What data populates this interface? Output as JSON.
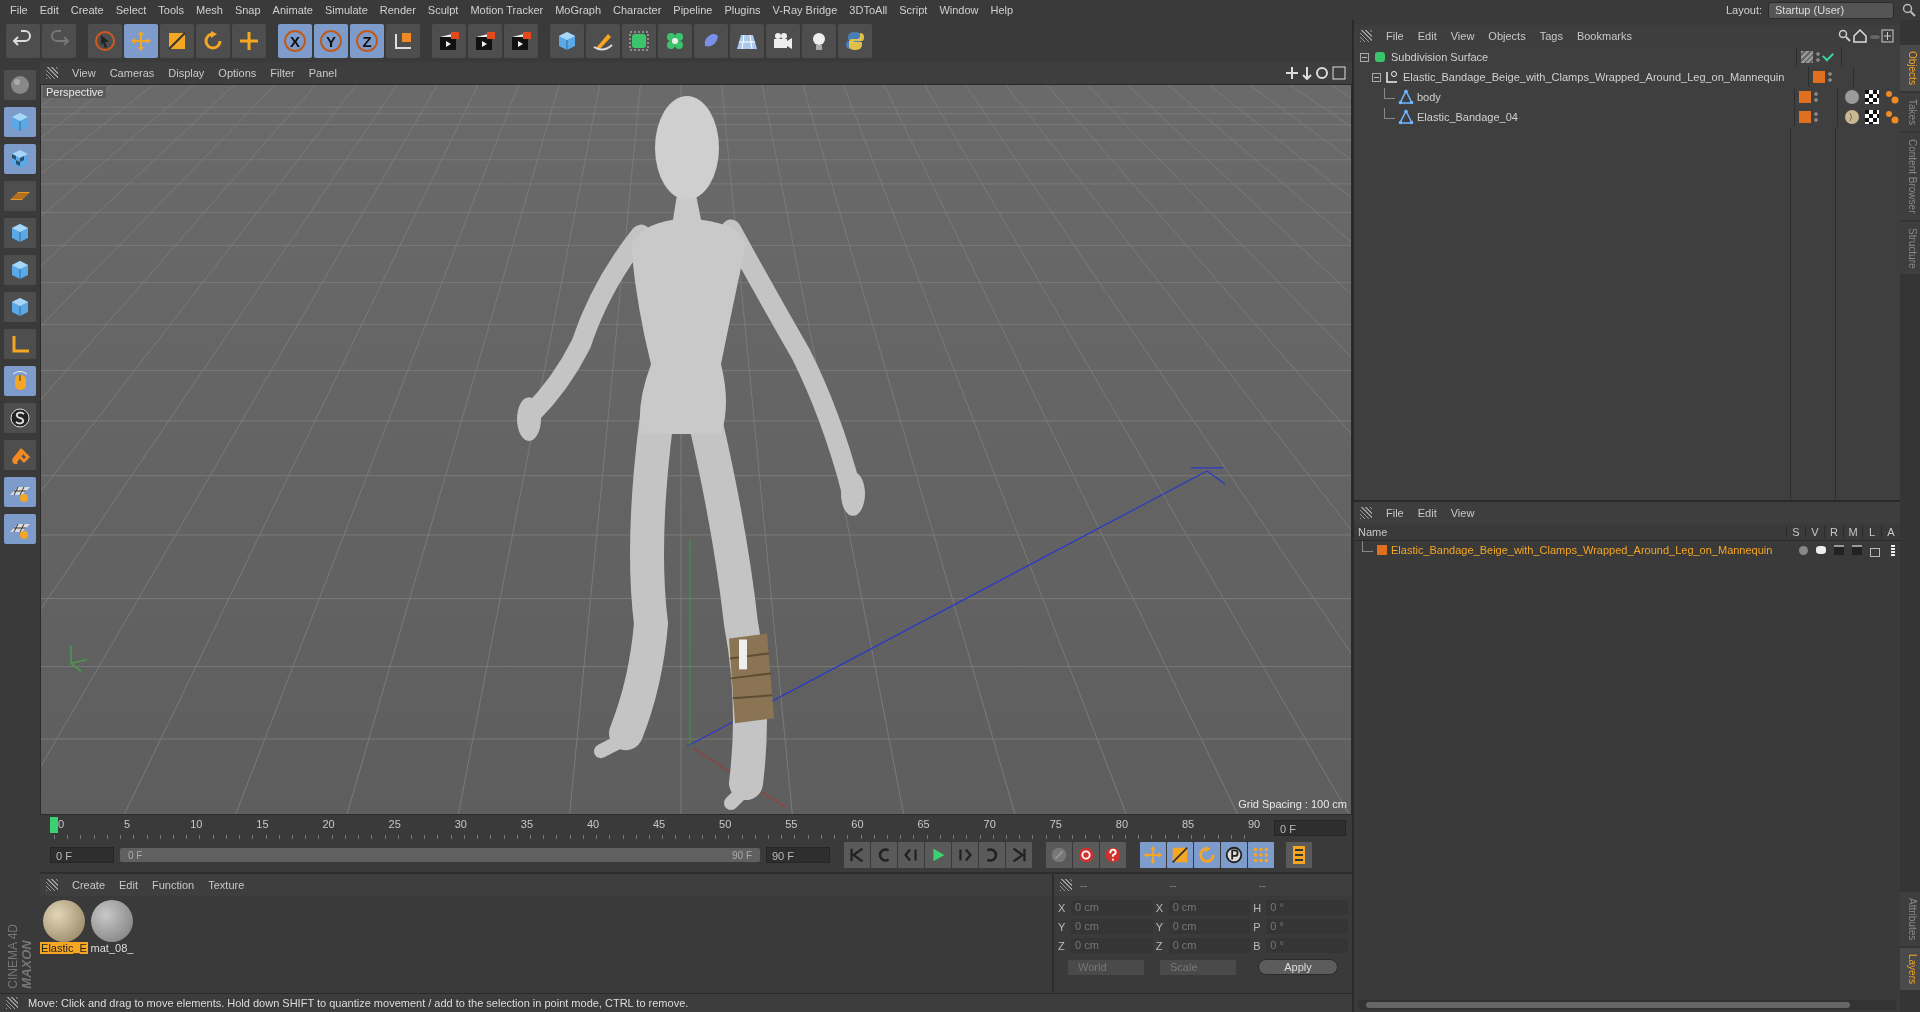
{
  "menu_bar": {
    "items": [
      "File",
      "Edit",
      "Create",
      "Select",
      "Tools",
      "Mesh",
      "Snap",
      "Animate",
      "Simulate",
      "Render",
      "Sculpt",
      "Motion Tracker",
      "MoGraph",
      "Character",
      "Pipeline",
      "Plugins",
      "V-Ray Bridge",
      "3DToAll",
      "Script",
      "Window",
      "Help"
    ],
    "layout_label": "Layout:",
    "layout_value": "Startup (User)"
  },
  "toolbar": [
    {
      "kind": "undo",
      "selected": false
    },
    {
      "kind": "redo",
      "selected": false
    },
    {
      "kind": "sep"
    },
    {
      "kind": "pointer",
      "selected": false
    },
    {
      "kind": "move",
      "selected": true
    },
    {
      "kind": "scale",
      "selected": false
    },
    {
      "kind": "rotate",
      "selected": false
    },
    {
      "kind": "plus",
      "selected": false
    },
    {
      "kind": "sep"
    },
    {
      "kind": "axis",
      "label": "X",
      "selected": true
    },
    {
      "kind": "axis",
      "label": "Y",
      "selected": true
    },
    {
      "kind": "axis",
      "label": "Z",
      "selected": true
    },
    {
      "kind": "coord",
      "selected": false
    },
    {
      "kind": "sep"
    },
    {
      "kind": "render",
      "selected": false
    },
    {
      "kind": "render",
      "selected": false
    },
    {
      "kind": "render",
      "selected": false
    },
    {
      "kind": "sep"
    },
    {
      "kind": "cube",
      "selected": false
    },
    {
      "kind": "pen",
      "selected": false
    },
    {
      "kind": "subdiv",
      "selected": false
    },
    {
      "kind": "cloner",
      "selected": false
    },
    {
      "kind": "deformer",
      "selected": false
    },
    {
      "kind": "floor",
      "selected": false
    },
    {
      "kind": "camera",
      "selected": false
    },
    {
      "kind": "light",
      "selected": false
    },
    {
      "kind": "python",
      "selected": false
    }
  ],
  "left_tools": [
    {
      "kind": "sphere",
      "selected": false
    },
    {
      "kind": "cube",
      "selected": true
    },
    {
      "kind": "checker",
      "selected": true
    },
    {
      "kind": "plane",
      "selected": false
    },
    {
      "kind": "cube",
      "selected": false
    },
    {
      "kind": "cube",
      "selected": false
    },
    {
      "kind": "cube",
      "selected": false
    },
    {
      "kind": "axis",
      "selected": false
    },
    {
      "kind": "mouse",
      "selected": true
    },
    {
      "kind": "snap",
      "selected": false
    },
    {
      "kind": "magnet",
      "selected": false
    },
    {
      "kind": "grid",
      "selected": true
    },
    {
      "kind": "grid",
      "selected": true
    }
  ],
  "viewport": {
    "menu": [
      "View",
      "Cameras",
      "Display",
      "Options",
      "Filter",
      "Panel"
    ],
    "camera_label": "Perspective",
    "grid_spacing": "Grid Spacing : 100 cm"
  },
  "timeline": {
    "ticks": [
      "0",
      "5",
      "10",
      "15",
      "20",
      "25",
      "30",
      "35",
      "40",
      "45",
      "50",
      "55",
      "60",
      "65",
      "70",
      "75",
      "80",
      "85",
      "90"
    ],
    "end_frame": "0 F",
    "current_frame": "0 F",
    "range_start": "0 F",
    "range_end": "90 F",
    "max_frame": "90 F",
    "transport": [
      {
        "kind": "first"
      },
      {
        "kind": "prev_key"
      },
      {
        "kind": "prev"
      },
      {
        "kind": "play"
      },
      {
        "kind": "next"
      },
      {
        "kind": "next_key"
      },
      {
        "kind": "last"
      }
    ],
    "keys": [
      {
        "kind": "key_off"
      },
      {
        "kind": "record"
      },
      {
        "kind": "help"
      }
    ],
    "range": {
      "level": 1
    },
    "modes": [
      {
        "kind": "move",
        "selected": true
      },
      {
        "kind": "scale",
        "selected": true
      },
      {
        "kind": "rotate",
        "selected": true
      },
      {
        "kind": "param",
        "selected": true
      },
      {
        "kind": "points",
        "selected": true
      }
    ]
  },
  "material_manager": {
    "menu": [
      "Create",
      "Edit",
      "Function",
      "Texture"
    ],
    "materials": [
      {
        "name": "Elastic_E",
        "kind": "fabric",
        "selected": true
      },
      {
        "name": "mat_08_",
        "kind": "plain",
        "selected": false
      }
    ]
  },
  "coordinates": {
    "headers": [
      "--",
      "--",
      "--"
    ],
    "rows": [
      [
        {
          "axis": "X",
          "value": "0 cm"
        },
        {
          "axis": "X",
          "value": "0 cm"
        },
        {
          "axis": "H",
          "value": "0 °"
        }
      ],
      [
        {
          "axis": "Y",
          "value": "0 cm"
        },
        {
          "axis": "Y",
          "value": "0 cm"
        },
        {
          "axis": "P",
          "value": "0 °"
        }
      ],
      [
        {
          "axis": "Z",
          "value": "0 cm"
        },
        {
          "axis": "Z",
          "value": "0 cm"
        },
        {
          "axis": "B",
          "value": "0 °"
        }
      ]
    ],
    "space": "World",
    "mode": "Scale",
    "apply": "Apply"
  },
  "brand": {
    "company": "MAXON",
    "product": "CINEMA 4D"
  },
  "status_bar": "Move: Click and drag to move elements. Hold down SHIFT to quantize movement / add to the selection in point mode, CTRL to remove.",
  "object_manager": {
    "menu": [
      "File",
      "Edit",
      "View",
      "Objects",
      "Tags",
      "Bookmarks"
    ],
    "objects": [
      {
        "name": "Subdivision Surface",
        "kind": "subdivision",
        "expanded": true,
        "children": [
          {
            "name": "Elastic_Bandage_Beige_with_Clamps_Wrapped_Around_Leg_on_Mannequin",
            "kind": "null",
            "expanded": true,
            "children": [
              {
                "name": "body",
                "kind": "polygon",
                "tags": [
                  {
                    "kind": "material"
                  },
                  {
                    "kind": "texture"
                  },
                  {
                    "kind": "selection"
                  }
                ]
              },
              {
                "name": "Elastic_Bandage_04",
                "kind": "polygon",
                "tags": [
                  {
                    "kind": "fabric"
                  },
                  {
                    "kind": "texture"
                  },
                  {
                    "kind": "selection"
                  }
                ]
              }
            ]
          }
        ]
      }
    ]
  },
  "layer_manager": {
    "menu": [
      "File",
      "Edit",
      "View"
    ],
    "columns": [
      "Name",
      "S",
      "V",
      "R",
      "M",
      "L",
      "A"
    ],
    "rows": [
      {
        "name": "Elastic_Bandage_Beige_with_Clamps_Wrapped_Around_Leg_on_Mannequin",
        "color": "#e0701f"
      }
    ]
  },
  "side_tabs_top": [
    {
      "label": "Objects",
      "selected": true
    },
    {
      "label": "Takes",
      "selected": false
    },
    {
      "label": "Content Browser",
      "selected": false
    },
    {
      "label": "Structure",
      "selected": false
    }
  ],
  "side_tabs_bottom": [
    {
      "label": "Attributes",
      "selected": false
    },
    {
      "label": "Layers",
      "selected": true
    }
  ]
}
